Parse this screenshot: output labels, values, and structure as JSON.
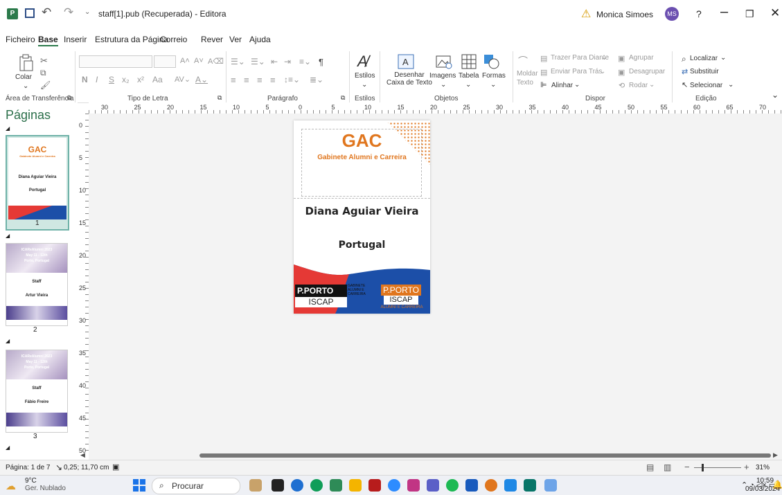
{
  "titlebar": {
    "app_icon": "P",
    "doc_title": "staff[1].pub (Recuperada) - Editora",
    "user_name": "Monica Simoes",
    "user_initials": "MS",
    "help": "?"
  },
  "menu": [
    "Ficheiro",
    "Base",
    "Inserir",
    "Estrutura da Página",
    "Correio",
    "Rever",
    "Ver",
    "Ajuda"
  ],
  "ribbon": {
    "paste": "Colar",
    "styles": "Estilos",
    "draw_textbox": "Desenhar\nCaixa de Texto",
    "images": "Imagens",
    "table": "Tabela",
    "shapes": "Formas",
    "wrap": "Moldar\nTexto",
    "bring_forward": "Trazer Para Diante",
    "send_backward": "Enviar Para Trás",
    "align": "Alinhar",
    "group": "Agrupar",
    "ungroup": "Desagrupar",
    "rotate": "Rodar",
    "find": "Localizar",
    "replace": "Substituir",
    "select": "Selecionar",
    "font_buttons": [
      "N",
      "I",
      "S",
      "x₂",
      "x²",
      "Aa"
    ],
    "group_labels": [
      "Área de Transferência",
      "Tipo de Letra",
      "Parágrafo",
      "Estilos",
      "Objetos",
      "Dispor",
      "Edição"
    ]
  },
  "ruler": {
    "h": [
      "30",
      "25",
      "20",
      "15",
      "10",
      "5",
      "0",
      "5",
      "10",
      "15",
      "20",
      "25",
      "30",
      "35",
      "40",
      "45",
      "50",
      "55",
      "60",
      "65",
      "70"
    ],
    "v": [
      "0",
      "5",
      "10",
      "15",
      "20",
      "25",
      "30",
      "35",
      "40",
      "45",
      "50"
    ]
  },
  "pages_panel": {
    "title": "Páginas",
    "thumbs": [
      {
        "num": "1",
        "lines": [
          "GAC",
          "Gabinete Alumni e Carreira",
          "Diana Aguiar Vieira",
          "Portugal"
        ]
      },
      {
        "num": "2",
        "lines": [
          "ICAReAlumni 2023",
          "May 11 - 12th",
          "Porto, Portugal",
          "Staff",
          "Artur Vieira"
        ]
      },
      {
        "num": "3",
        "lines": [
          "ICAReAlumni 2023",
          "May 11 - 12th",
          "Porto, Portugal",
          "Staff",
          "Fábio Freire"
        ]
      }
    ]
  },
  "page": {
    "logo": "GAC",
    "subtitle": "Gabinete Alumni e Carreira",
    "name": "Diana Aguiar Vieira",
    "country": "Portugal",
    "porto1": "P.PORTO",
    "iscap1": "ISCAP",
    "small1": "GABINETE\nALUMNI E\nCARREIRA",
    "porto2": "P.PORTO",
    "iscap2": "ISCAP",
    "small2": "ALUMNI E CARREIRA"
  },
  "statusbar": {
    "page_info": "Página: 1 de 7",
    "position": "0,25; 11,70 cm",
    "zoom": "31%"
  },
  "taskbar": {
    "temp": "9°C",
    "weather": "Ger. Nublado",
    "search_placeholder": "Procurar",
    "time": "10:59",
    "date": "09/03/2024"
  },
  "colors": {
    "accent": "#2b7a4b",
    "orange": "#e0761e",
    "red": "#e53935",
    "blue": "#1c4fa8"
  }
}
